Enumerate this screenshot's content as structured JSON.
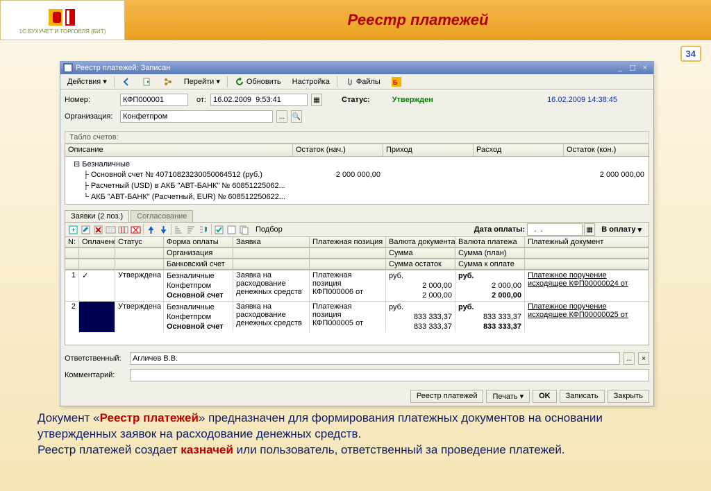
{
  "slide": {
    "title": "Реестр платежей",
    "logo_caption": "1С:БУХУЧЕТ И ТОРГОВЛЯ (БИТ)",
    "page_num": "34"
  },
  "win": {
    "title": "Реестр платежей: Записан"
  },
  "toolbar": {
    "actions": "Действия",
    "nav": "Перейти",
    "refresh": "Обновить",
    "setup": "Настройка",
    "files": "Файлы"
  },
  "form": {
    "label_number": "Номер:",
    "number": "КФП000001",
    "label_from": "от:",
    "date": "16.02.2009  9:53:41",
    "label_status": "Статус:",
    "status": "Утвержден",
    "timestamp": "16.02.2009 14:38:45",
    "label_org": "Организация:",
    "org": "Конфетпром",
    "section_accounts": "Табло счетов:"
  },
  "grid_head": {
    "desc": "Описание",
    "start": "Остаток (нач.)",
    "in": "Приход",
    "out": "Расход",
    "end": "Остаток (кон.)"
  },
  "tree": {
    "root": "Безналичные",
    "r1": "Основной счет № 40710823230050064512 (руб.)",
    "r1_start": "2 000 000,00",
    "r1_end": "2 000 000,00",
    "r2": "Расчетный (USD) в АКБ \"АВТ-БАНК\" № 60851225062...",
    "r3": "АКБ \"АВТ-БАНК\" (Расчетный, EUR) № 608512250622..."
  },
  "tabs": {
    "t1": "Заявки (2 поз.)",
    "t2": "Согласование"
  },
  "subtb": {
    "pick": "Подбор",
    "lbl_date": "Дата оплаты:",
    "to_pay": "В оплату"
  },
  "dhead": {
    "n": "N:",
    "paid": "Оплачено",
    "status": "Статус",
    "form": "Форма оплаты",
    "org": "Организация",
    "bank": "Банковский счет",
    "zay": "Заявка",
    "pos": "Платежная позиция",
    "curdoc": "Валюта документа",
    "sum": "Сумма",
    "sumrem": "Сумма остаток",
    "curpay": "Валюта платежа",
    "sumplan": "Сумма (план)",
    "sumtopay": "Сумма к оплате",
    "paydoc": "Платежный документ"
  },
  "rows": [
    {
      "n": "1",
      "paid": "✓",
      "status": "Утверждена",
      "form": "Безналичные",
      "org": "Конфетпром",
      "bank": "Основной счет",
      "zay": "Заявка на расходование денежных средств",
      "pos": "Платежная позиция КФП000006 от",
      "cur": "руб.",
      "sum": "2 000,00",
      "sumrem": "2 000,00",
      "cur2": "руб.",
      "sum2": "2 000,00",
      "sum3": "2 000,00",
      "doc": "Платежное поручение исходящее КФП00000024 от"
    },
    {
      "n": "2",
      "paid": "",
      "status": "Утверждена",
      "form": "Безналичные",
      "org": "Конфетпром",
      "bank": "Основной счет",
      "zay": "Заявка на расходование денежных средств",
      "pos": "Платежная позиция КФП000005 от",
      "cur": "руб.",
      "sum": "833 333,37",
      "sumrem": "833 333,37",
      "cur2": "руб.",
      "sum2": "833 333,37",
      "sum3": "833 333,37",
      "doc": "Платежное поручение исходящее КФП00000025 от"
    }
  ],
  "foot": {
    "label_resp": "Ответственный:",
    "resp": "Агличев В.В.",
    "label_comm": "Комментарий:",
    "comm": "",
    "b_reg": "Реестр платежей",
    "b_print": "Печать",
    "b_ok": "OK",
    "b_save": "Записать",
    "b_close": "Закрыть"
  },
  "desc": {
    "p1a": "Документ «",
    "p1b": "Реестр платежей",
    "p1c": "» предназначен для формирования платежных документов на основании утвержденных заявок на расходование денежных средств.",
    "p2a": "Реестр платежей создает ",
    "p2b": "казначей",
    "p2c": " или пользователь, ответственный за проведение платежей."
  }
}
